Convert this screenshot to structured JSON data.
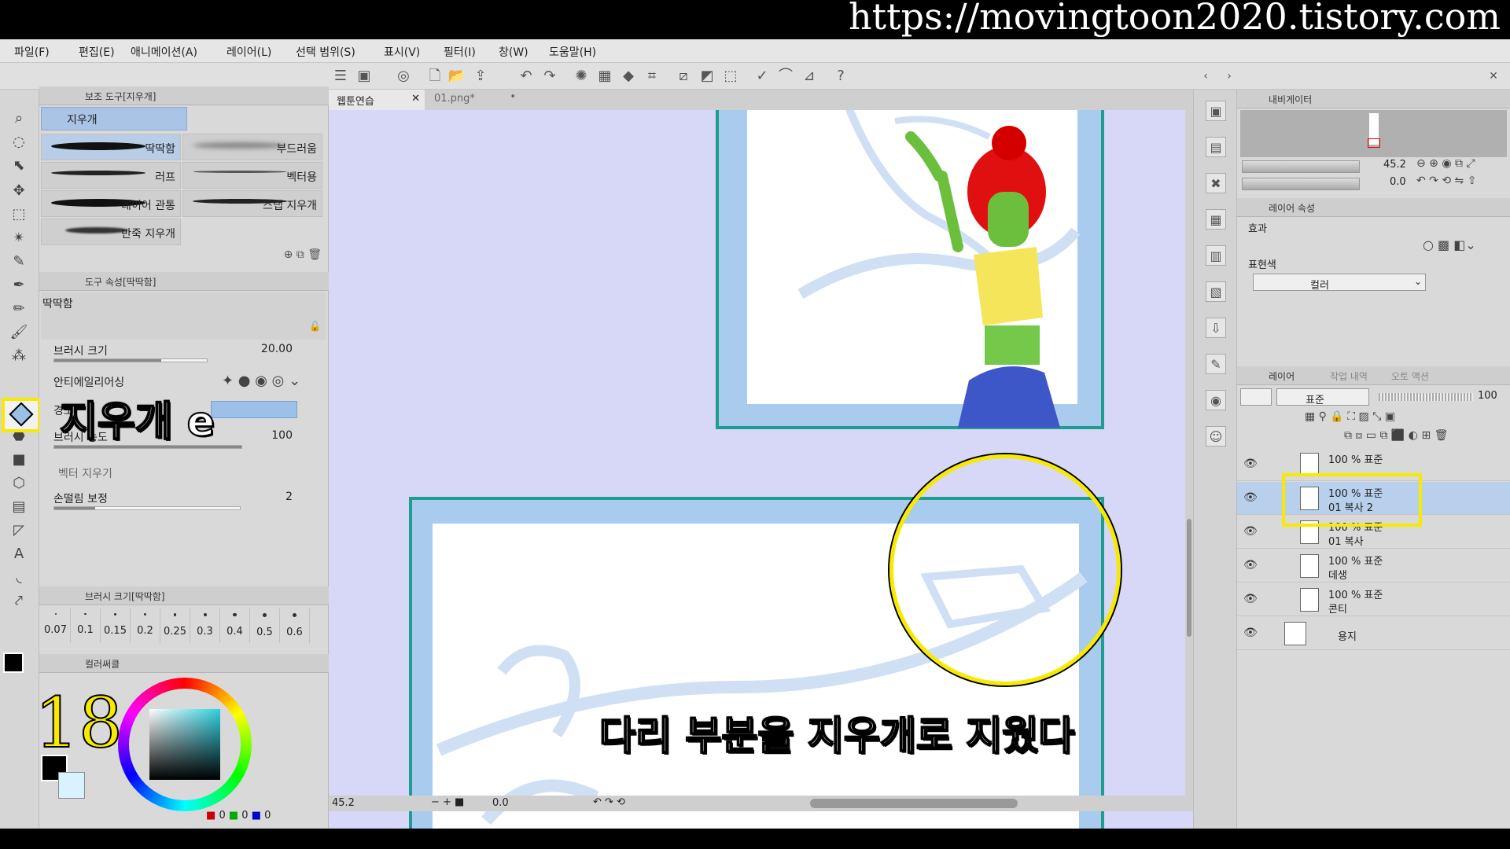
{
  "watermark_url": "https://movingtoon2020.tistory.com",
  "menu": [
    "파일(F)",
    "편집(E)",
    "애니메이션(A)",
    "레이어(L)",
    "선택 범위(S)",
    "표시(V)",
    "필터(I)",
    "창(W)",
    "도움말(H)"
  ],
  "subtool": {
    "header": "보조 도구[지우개]",
    "group": "지우개",
    "brushes": [
      {
        "label": "딱딱함"
      },
      {
        "label": "부드러움"
      },
      {
        "label": "러프"
      },
      {
        "label": "벡터용"
      },
      {
        "label": "레이어 관통"
      },
      {
        "label": "스냅 지우개"
      },
      {
        "label": "반죽 지우개"
      }
    ]
  },
  "tool_property": {
    "header": "도구 속성[딱딱함]",
    "preset_name": "딱딱함",
    "brush_size_label": "브러시 크기",
    "brush_size_value": "20.00",
    "brush_size_fill": 0.7,
    "antialias_label": "안티에일리어싱",
    "hardness_label": "경도",
    "density_label": "브러시 농도",
    "density_value": "100",
    "vector_erase_label": "벡터 지우기",
    "stabilization_label": "손떨림 보정",
    "stabilization_value": "2"
  },
  "brush_size_panel": {
    "header": "브러시 크기[딱딱함]",
    "sizes": [
      "0.07",
      "0.1",
      "0.15",
      "0.2",
      "0.25",
      "0.3",
      "0.4",
      "0.5",
      "0.6"
    ]
  },
  "color_panel": {
    "header": "컬러써클",
    "r": "0",
    "g": "0",
    "b": "0",
    "main_color": "#000000",
    "sub_color": "#d8f2ff"
  },
  "doc_tabs": [
    {
      "label": "웹툰연습",
      "active": true
    },
    {
      "label": "01.png*",
      "active": false
    }
  ],
  "status": {
    "zoom": "45.2",
    "rotation": "0.0"
  },
  "navigator": {
    "header": "내비게이터",
    "zoom": "45.2",
    "rotation": "0.0"
  },
  "layer_property": {
    "header": "레이어 속성",
    "effect_label": "효과",
    "display_color_label": "표현색",
    "display_color_value": "컬러"
  },
  "layer_panel": {
    "tabs": [
      "레이어",
      "작업 내역",
      "오토 액션"
    ],
    "blend_mode": "표준",
    "opacity": "100",
    "layers": [
      {
        "line1": "100 % 표준",
        "line2": ""
      },
      {
        "line1": "100 % 표준",
        "line2": "01 복사 2"
      },
      {
        "line1": "100 % 표준",
        "line2": "01 복사"
      },
      {
        "line1": "100 % 표준",
        "line2": "데생"
      },
      {
        "line1": "100 % 표준",
        "line2": "콘티"
      },
      {
        "line1": "",
        "line2": "용지"
      }
    ]
  },
  "captions": {
    "tool_note": "지우개 e",
    "step_number": "18",
    "main_note": "다리 부분을 지우개로 지웠다"
  }
}
